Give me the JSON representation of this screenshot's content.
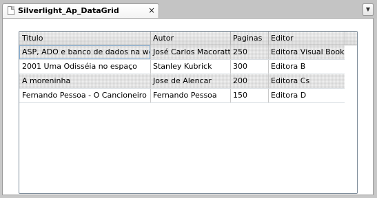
{
  "tab": {
    "title": "Silverlight_Ap_DataGrid",
    "close_glyph": "×",
    "menu_glyph": "▼"
  },
  "grid": {
    "columns": [
      "Titulo",
      "Autor",
      "Paginas",
      "Editor"
    ],
    "rows": [
      {
        "titulo": "ASP, ADO e banco de dados na web",
        "autor": "José Carlos Macoratti",
        "paginas": "250",
        "editor": "Editora Visual Books"
      },
      {
        "titulo": "2001 Uma Odisséia no espaço",
        "autor": "Stanley Kubrick",
        "paginas": "300",
        "editor": "Editora B"
      },
      {
        "titulo": "A moreninha",
        "autor": "Jose de Alencar",
        "paginas": "200",
        "editor": "Editora Cs"
      },
      {
        "titulo": "Fernando Pessoa - O Cancioneiro",
        "autor": "Fernando Pessoa",
        "paginas": "150",
        "editor": "Editora D"
      }
    ]
  }
}
